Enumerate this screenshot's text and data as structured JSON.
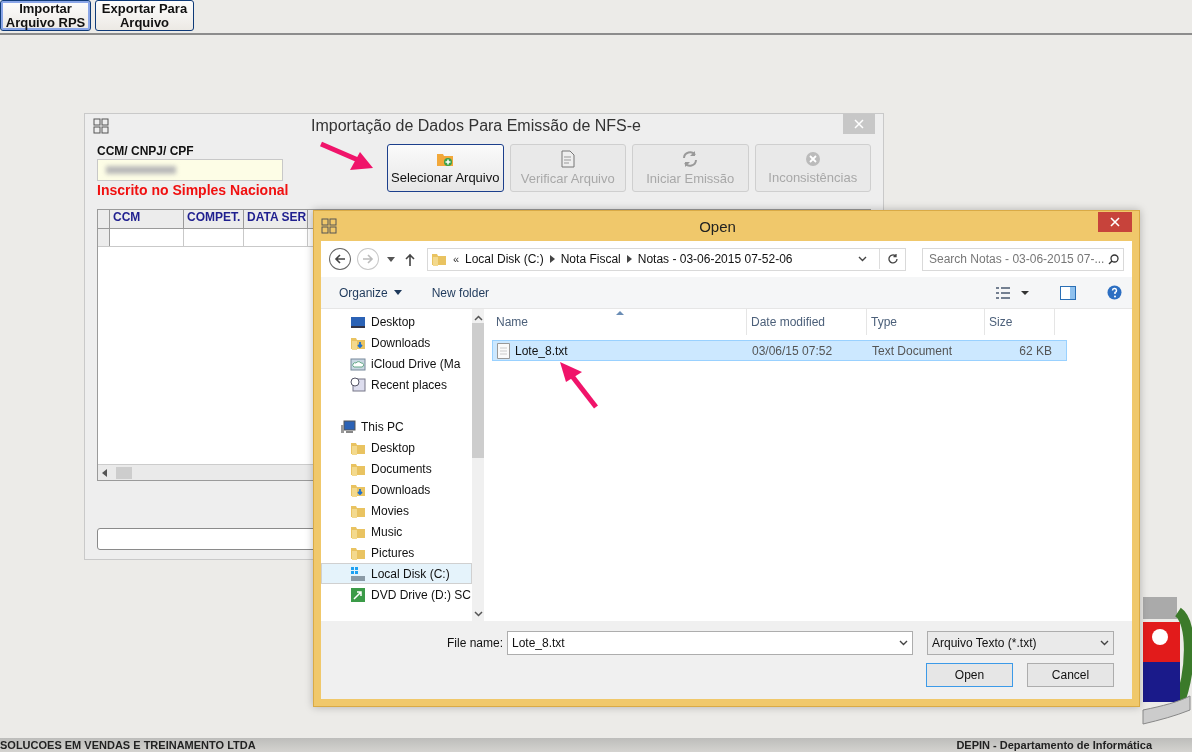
{
  "toolbar": {
    "buttons": [
      {
        "lines": [
          "Importar",
          "Arquivo RPS"
        ],
        "selected": true
      },
      {
        "lines": [
          "Exportar Para",
          "Arquivo"
        ],
        "selected": false
      }
    ]
  },
  "import_window": {
    "title": "Importação de Dados Para Emissão de NFS-e",
    "field_label": "CCM/ CNPJ/ CPF",
    "notice": "Inscrito no Simples Nacional",
    "buttons": [
      {
        "label": "Selecionar Arquivo",
        "disabled": false
      },
      {
        "label": "Verificar Arquivo",
        "disabled": true
      },
      {
        "label": "Iniciar Emissão",
        "disabled": true
      },
      {
        "label": "Inconsistências",
        "disabled": true
      }
    ],
    "table": {
      "columns": [
        "CCM",
        "COMPET.",
        "DATA SER"
      ]
    },
    "progress": {
      "level": 0
    }
  },
  "open_dialog": {
    "title": "Open",
    "address_overflow": "«",
    "address": [
      "Local Disk (C:)",
      "Nota Fiscal",
      "Notas - 03-06-2015 07-52-06"
    ],
    "search": {
      "placeholder": "Search Notas - 03-06-2015 07-..."
    },
    "commands": [
      "Organize",
      "New folder"
    ],
    "nav": [
      {
        "label": "Desktop",
        "selected": false
      },
      {
        "label": "Downloads",
        "selected": false
      },
      {
        "label": "iCloud Drive (Ma",
        "selected": false
      },
      {
        "label": "Recent places",
        "selected": false
      },
      {
        "label": "This PC",
        "selected": false,
        "children": [
          {
            "label": "Desktop",
            "selected": false
          },
          {
            "label": "Documents",
            "selected": false
          },
          {
            "label": "Downloads",
            "selected": false
          },
          {
            "label": "Movies",
            "selected": false
          },
          {
            "label": "Music",
            "selected": false
          },
          {
            "label": "Pictures",
            "selected": false
          },
          {
            "label": "Local Disk (C:)",
            "selected": true
          },
          {
            "label": "DVD Drive (D:) SC",
            "selected": false
          }
        ]
      }
    ],
    "columns": [
      "Name",
      "Date modified",
      "Type",
      "Size"
    ],
    "files": [
      {
        "name": "Lote_8.txt",
        "date": "03/06/15 07:52",
        "type": "Text Document",
        "size": "62 KB",
        "selected": true
      }
    ],
    "file_name": {
      "label": "File name:",
      "value": "Lote_8.txt"
    },
    "filter": "Arquivo Texto (*.txt)",
    "buttons": [
      {
        "label": "Open",
        "default": true
      },
      {
        "label": "Cancel",
        "default": false
      }
    ]
  },
  "status_bar": {
    "left": "SOLUCOES EM VENDAS E TREINAMENTO LTDA",
    "right": "DEPIN - Departamento de Informática"
  }
}
